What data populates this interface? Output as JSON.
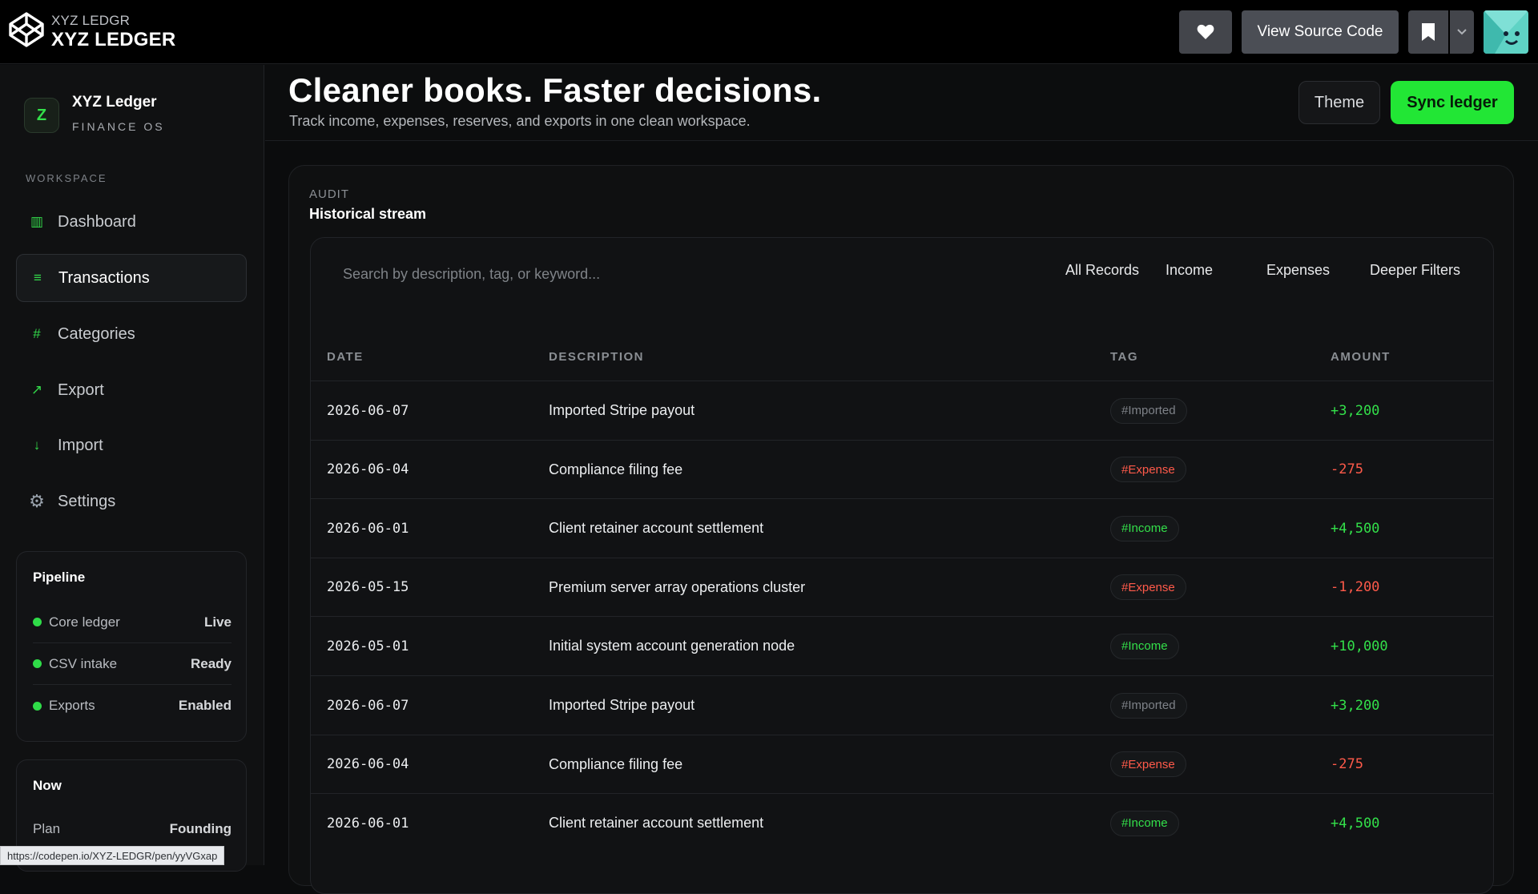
{
  "codepen": {
    "brand_small": "XYZ LEDGR",
    "brand_big": "XYZ LEDGER",
    "source_label": "View Source Code",
    "url_tip": "https://codepen.io/XYZ-LEDGR/pen/yyVGxap"
  },
  "sidebar": {
    "brand_mark": "Z",
    "brand_name": "XYZ Ledger",
    "brand_sub": "FINANCE OS",
    "workspace_label": "WORKSPACE",
    "nav": [
      {
        "label": "Dashboard",
        "icon": "▥"
      },
      {
        "label": "Transactions",
        "icon": "≡"
      },
      {
        "label": "Categories",
        "icon": "#"
      },
      {
        "label": "Export",
        "icon": "↗"
      },
      {
        "label": "Import",
        "icon": "↓"
      },
      {
        "label": "Settings",
        "icon": "⚙"
      }
    ],
    "pipeline": {
      "title": "Pipeline",
      "rows": [
        {
          "label": "Core ledger",
          "status": "Live"
        },
        {
          "label": "CSV intake",
          "status": "Ready"
        },
        {
          "label": "Exports",
          "status": "Enabled"
        }
      ]
    },
    "now": {
      "title": "Now",
      "plan_label": "Plan",
      "plan_value": "Founding"
    }
  },
  "header": {
    "title": "Cleaner books. Faster decisions.",
    "subtitle": "Track income, expenses, reserves, and exports in one clean workspace.",
    "theme_label": "Theme",
    "sync_label": "Sync ledger"
  },
  "audit": {
    "label": "AUDIT",
    "title": "Historical stream",
    "search_placeholder": "Search by description, tag, or keyword...",
    "filters": [
      "All Records",
      "Income",
      "Expenses",
      "Deeper Filters"
    ],
    "columns": [
      "DATE",
      "DESCRIPTION",
      "TAG",
      "AMOUNT"
    ],
    "rows": [
      {
        "date": "2026-06-07",
        "description": "Imported Stripe payout",
        "tag": "#Imported",
        "tag_type": "Imported",
        "amount": "+3,200",
        "sign": "pos"
      },
      {
        "date": "2026-06-04",
        "description": "Compliance filing fee",
        "tag": "#Expense",
        "tag_type": "Expense",
        "amount": "-275",
        "sign": "neg"
      },
      {
        "date": "2026-06-01",
        "description": "Client retainer account settlement",
        "tag": "#Income",
        "tag_type": "Income",
        "amount": "+4,500",
        "sign": "pos"
      },
      {
        "date": "2026-05-15",
        "description": "Premium server array operations cluster",
        "tag": "#Expense",
        "tag_type": "Expense",
        "amount": "-1,200",
        "sign": "neg"
      },
      {
        "date": "2026-05-01",
        "description": "Initial system account generation node",
        "tag": "#Income",
        "tag_type": "Income",
        "amount": "+10,000",
        "sign": "pos"
      },
      {
        "date": "2026-06-07",
        "description": "Imported Stripe payout",
        "tag": "#Imported",
        "tag_type": "Imported",
        "amount": "+3,200",
        "sign": "pos"
      },
      {
        "date": "2026-06-04",
        "description": "Compliance filing fee",
        "tag": "#Expense",
        "tag_type": "Expense",
        "amount": "-275",
        "sign": "neg"
      },
      {
        "date": "2026-06-01",
        "description": "Client retainer account settlement",
        "tag": "#Income",
        "tag_type": "Income",
        "amount": "+4,500",
        "sign": "pos"
      }
    ]
  },
  "colors": {
    "accent": "#22e635",
    "income": "#33e04a",
    "expense": "#ff5a4a",
    "background": "#0b0c0d"
  }
}
